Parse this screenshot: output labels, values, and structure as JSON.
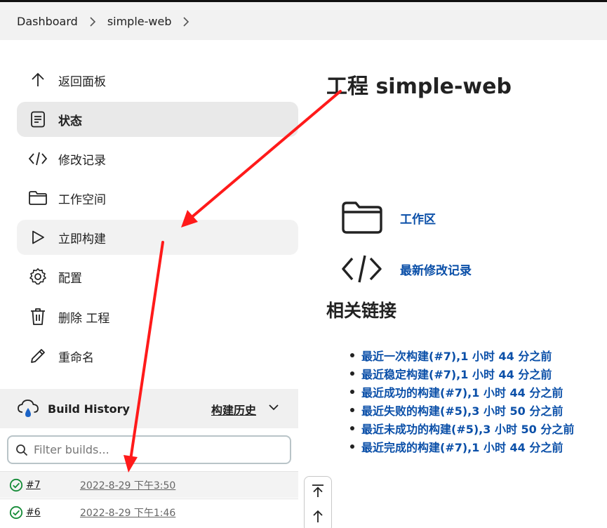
{
  "breadcrumb": {
    "items": [
      "Dashboard",
      "simple-web"
    ]
  },
  "sidebar": {
    "items": [
      {
        "label": "返回面板",
        "icon": "arrow-up-icon"
      },
      {
        "label": "状态",
        "icon": "document-icon"
      },
      {
        "label": "修改记录",
        "icon": "code-icon"
      },
      {
        "label": "工作空间",
        "icon": "folder-icon"
      },
      {
        "label": "立即构建",
        "icon": "play-icon"
      },
      {
        "label": "配置",
        "icon": "gear-icon"
      },
      {
        "label": "删除 工程",
        "icon": "trash-icon"
      },
      {
        "label": "重命名",
        "icon": "pencil-icon"
      }
    ]
  },
  "build_history": {
    "title": "Build History",
    "trend_label": "构建历史",
    "filter_placeholder": "Filter builds...",
    "builds": [
      {
        "number": "#7",
        "date": "2022-8-29 下午3:50",
        "status": "success"
      },
      {
        "number": "#6",
        "date": "2022-8-29 下午1:46",
        "status": "success"
      }
    ]
  },
  "main": {
    "title": "工程 simple-web",
    "workspace_link": "工作区",
    "changes_link": "最新修改记录",
    "related_title": "相关链接",
    "related_links": [
      "最近一次构建(#7),1 小时 44 分之前",
      "最近稳定构建(#7),1 小时 44 分之前",
      "最近成功的构建(#7),1 小时 44 分之前",
      "最近失败的构建(#5),3 小时 50 分之前",
      "最近未成功的构建(#5),3 小时 50 分之前",
      "最近完成的构建(#7),1 小时 44 分之前"
    ]
  },
  "colors": {
    "link": "#0a4fa8",
    "success": "#138a36",
    "annotation_arrow": "#ff1a1a"
  }
}
